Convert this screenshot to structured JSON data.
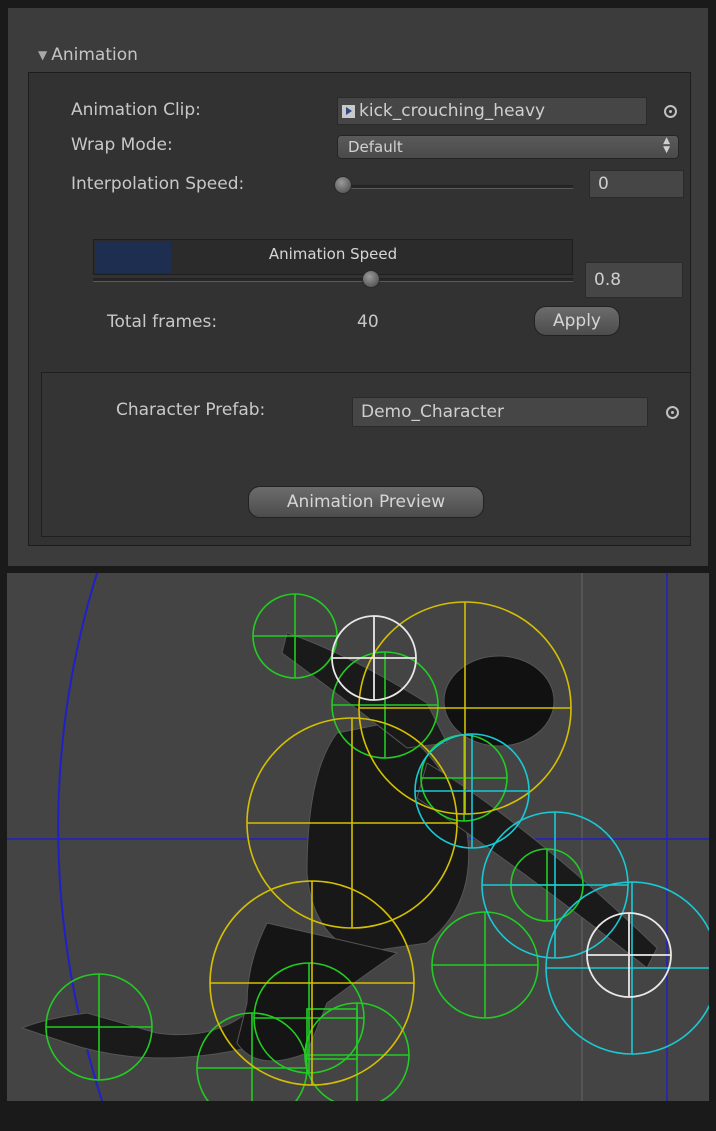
{
  "section": {
    "title": "Animation"
  },
  "animation_clip": {
    "label": "Animation Clip:",
    "value": "kick_crouching_heavy"
  },
  "wrap_mode": {
    "label": "Wrap Mode:",
    "value": "Default"
  },
  "interpolation_speed": {
    "label": "Interpolation Speed:",
    "value": "0",
    "fraction": 0.0
  },
  "animation_speed": {
    "label": "Animation Speed",
    "value": "0.8",
    "bar_fraction": 0.16,
    "slider_fraction": 0.58
  },
  "total_frames": {
    "label": "Total frames:",
    "value": "40"
  },
  "apply_button": {
    "label": "Apply"
  },
  "character_prefab": {
    "label": "Character Prefab:",
    "value": "Demo_Character"
  },
  "preview_button": {
    "label": "Animation Preview"
  },
  "colors": {
    "progress_fill": "#1e2e50",
    "collider_green": "#22cc22",
    "collider_yellow": "#d4c000",
    "collider_cyan": "#19c9d4",
    "collider_white": "#e8e8e8",
    "axis_blue": "#2020c8"
  }
}
